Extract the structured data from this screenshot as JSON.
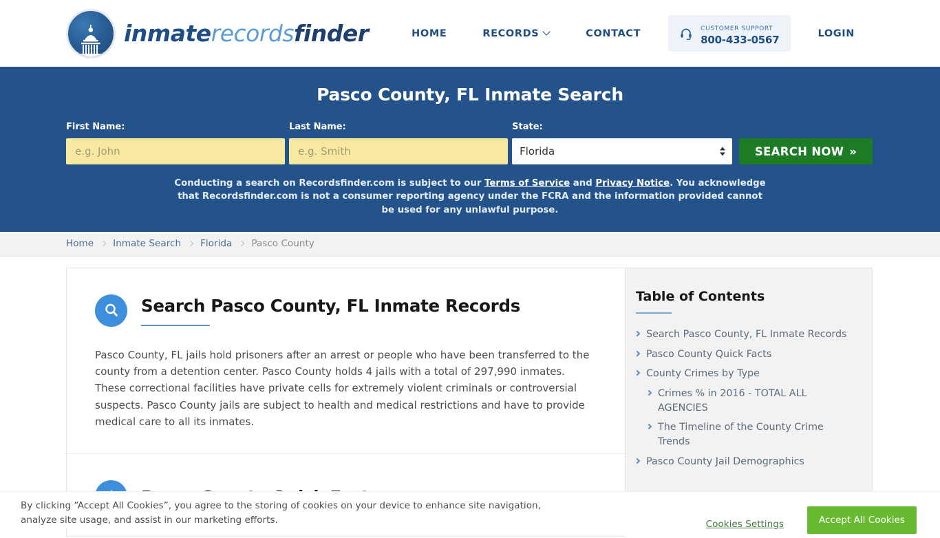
{
  "header": {
    "logo": {
      "icon": "capitol-building-icon",
      "part1": "inmate",
      "part2": "records",
      "part3": "finder"
    },
    "nav": [
      {
        "label": "HOME",
        "name": "nav-home",
        "caret": false
      },
      {
        "label": "RECORDS",
        "name": "nav-records",
        "caret": true
      },
      {
        "label": "CONTACT",
        "name": "nav-contact",
        "caret": false
      }
    ],
    "support": {
      "icon": "headset-icon",
      "label": "CUSTOMER SUPPORT",
      "phone": "800-433-0567"
    },
    "login_label": "LOGIN"
  },
  "hero": {
    "title": "Pasco County, FL Inmate Search",
    "background_color": "#24528a",
    "fields": {
      "first_name_label": "First Name:",
      "first_name_value": "",
      "first_name_placeholder": "e.g. John",
      "last_name_label": "Last Name:",
      "last_name_value": "",
      "last_name_placeholder": "e.g. Smith",
      "state_label": "State:",
      "state_value": "Florida"
    },
    "search_button": "SEARCH NOW",
    "search_button_chevron": "»",
    "search_button_color": "#1d7a25",
    "disclaimer": {
      "part1": "Conducting a search on Recordsfinder.com is subject to our ",
      "link1": "Terms of Service",
      "part2": " and ",
      "link2": "Privacy Notice",
      "part3": ". You acknowledge that Recordsfinder.com is not a consumer reporting agency under the FCRA and the information provided cannot be used for any unlawful purpose."
    }
  },
  "breadcrumb": [
    {
      "label": "Home",
      "name": "breadcrumb-home",
      "current": false
    },
    {
      "label": "Inmate Search",
      "name": "breadcrumb-inmate-search",
      "current": false
    },
    {
      "label": "Florida",
      "name": "breadcrumb-florida",
      "current": false
    },
    {
      "label": "Pasco County",
      "name": "breadcrumb-pasco-county",
      "current": true
    }
  ],
  "main": {
    "sections": [
      {
        "icon": "search-circle-icon",
        "title": "Search Pasco County, FL Inmate Records",
        "body": "Pasco County, FL jails hold prisoners after an arrest or people who have been transferred to the county from a detention center. Pasco County holds 4 jails with a total of 297,990 inmates. These correctional facilities have private cells for extremely violent criminals or controversial suspects. Pasco County jails are subject to health and medical restrictions and have to provide medical care to all its inmates."
      },
      {
        "icon": "warning-circle-icon",
        "title": "Pasco County Quick Facts",
        "body": ""
      }
    ]
  },
  "toc": {
    "title": "Table of Contents",
    "items": [
      {
        "label": "Search Pasco County, FL Inmate Records",
        "sub": false
      },
      {
        "label": "Pasco County Quick Facts",
        "sub": false
      },
      {
        "label": "County Crimes by Type",
        "sub": false
      },
      {
        "label": "Crimes % in 2016 - TOTAL ALL AGENCIES",
        "sub": true
      },
      {
        "label": "The Timeline of the County Crime Trends",
        "sub": true
      },
      {
        "label": "Pasco County Jail Demographics",
        "sub": false
      }
    ]
  },
  "cookie_banner": {
    "text": "By clicking “Accept All Cookies”, you agree to the storing of cookies on your device to enhance site navigation, analyze site usage, and assist in our marketing efforts.",
    "settings_label": "Cookies Settings",
    "accept_label": "Accept All Cookies",
    "accept_color": "#68bb31"
  }
}
